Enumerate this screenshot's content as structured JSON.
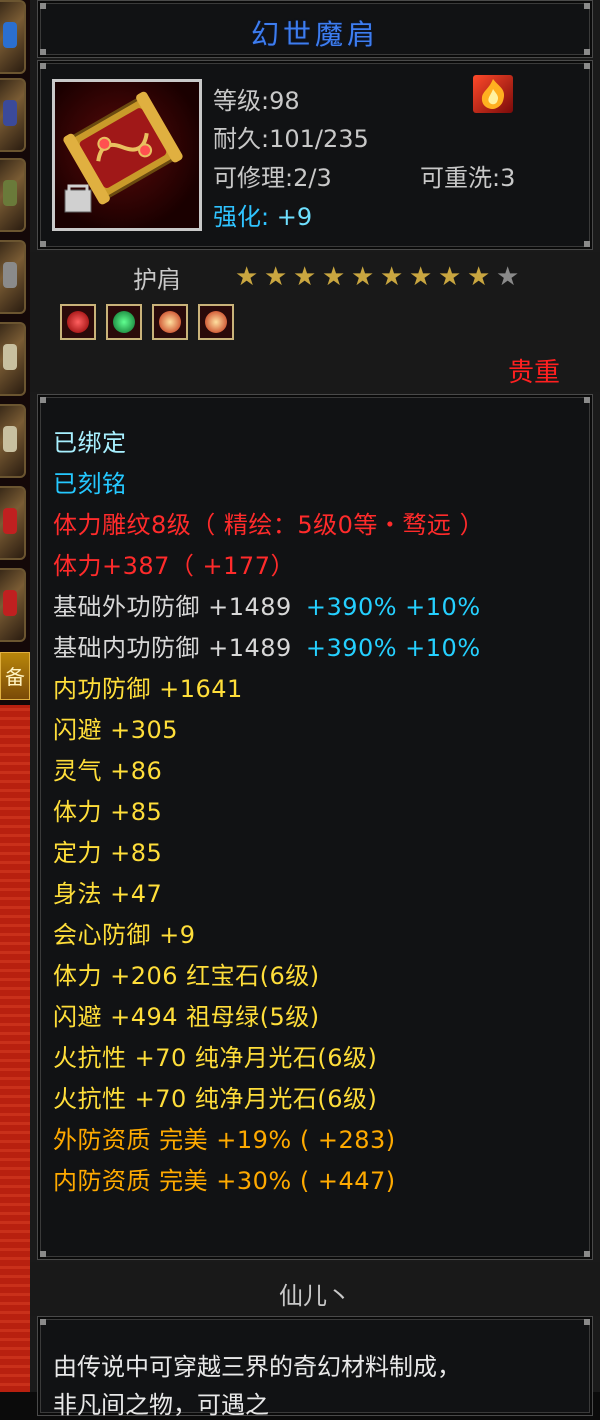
{
  "item": {
    "name": "幻世魔肩",
    "level_text": "等级:98",
    "durability_text": "耐久:101/235",
    "repair_text": "可修理:2/3",
    "rewash_text": "可重洗:3",
    "enhance_label": "强化:",
    "enhance_value": "+9",
    "type": "护肩",
    "stars_total": 10,
    "stars_filled": 9,
    "quality": "贵重",
    "icon": "shoulder-guard-icon",
    "badge_icon": "fire-badge-icon",
    "gems": [
      "red-gem-icon",
      "green-gem-icon",
      "moonstone-gem-icon",
      "moonstone-gem-icon"
    ]
  },
  "attributes": [
    {
      "text": "已绑定",
      "color": "#a8f0ff"
    },
    {
      "text": "已刻铭",
      "color": "#25c8ff"
    },
    {
      "text": "体力雕纹8级（ 精绘：5级0等・骛远 ）",
      "color": "#ff2b2b"
    },
    {
      "text": "体力+387（ +177）",
      "color": "#ff2b2b"
    },
    {
      "text": "基础外功防御 +1489",
      "extra": "+390% +10%",
      "color": "#d8d8d8"
    },
    {
      "text": "基础内功防御 +1489",
      "extra": "+390% +10%",
      "color": "#d8d8d8"
    },
    {
      "text": "内功防御 +1641",
      "color": "#ffde3a"
    },
    {
      "text": "闪避 +305",
      "color": "#ffde3a"
    },
    {
      "text": "灵气 +86",
      "color": "#ffde3a"
    },
    {
      "text": "体力 +85",
      "color": "#ffde3a"
    },
    {
      "text": "定力 +85",
      "color": "#ffde3a"
    },
    {
      "text": "身法 +47",
      "color": "#ffde3a"
    },
    {
      "text": "会心防御 +9",
      "color": "#ffde3a"
    },
    {
      "text": "体力 +206 红宝石(6级)",
      "color": "#ffde3a"
    },
    {
      "text": "闪避 +494 祖母绿(5级)",
      "color": "#ffde3a"
    },
    {
      "text": "火抗性 +70 纯净月光石(6级)",
      "color": "#ffde3a"
    },
    {
      "text": "火抗性 +70 纯净月光石(6级)",
      "color": "#ffde3a"
    },
    {
      "text": "外防资质 完美 +19% ( +283)",
      "color": "#ffaa00"
    },
    {
      "text": "内防资质 完美 +30% ( +447)",
      "color": "#ffaa00"
    }
  ],
  "owner": "仙儿丶",
  "description": {
    "line1": "由传说中可穿越三界的奇幻材料制成，",
    "line2": "非凡间之物，可遇之"
  },
  "left_strip": {
    "tab_label": "备"
  }
}
